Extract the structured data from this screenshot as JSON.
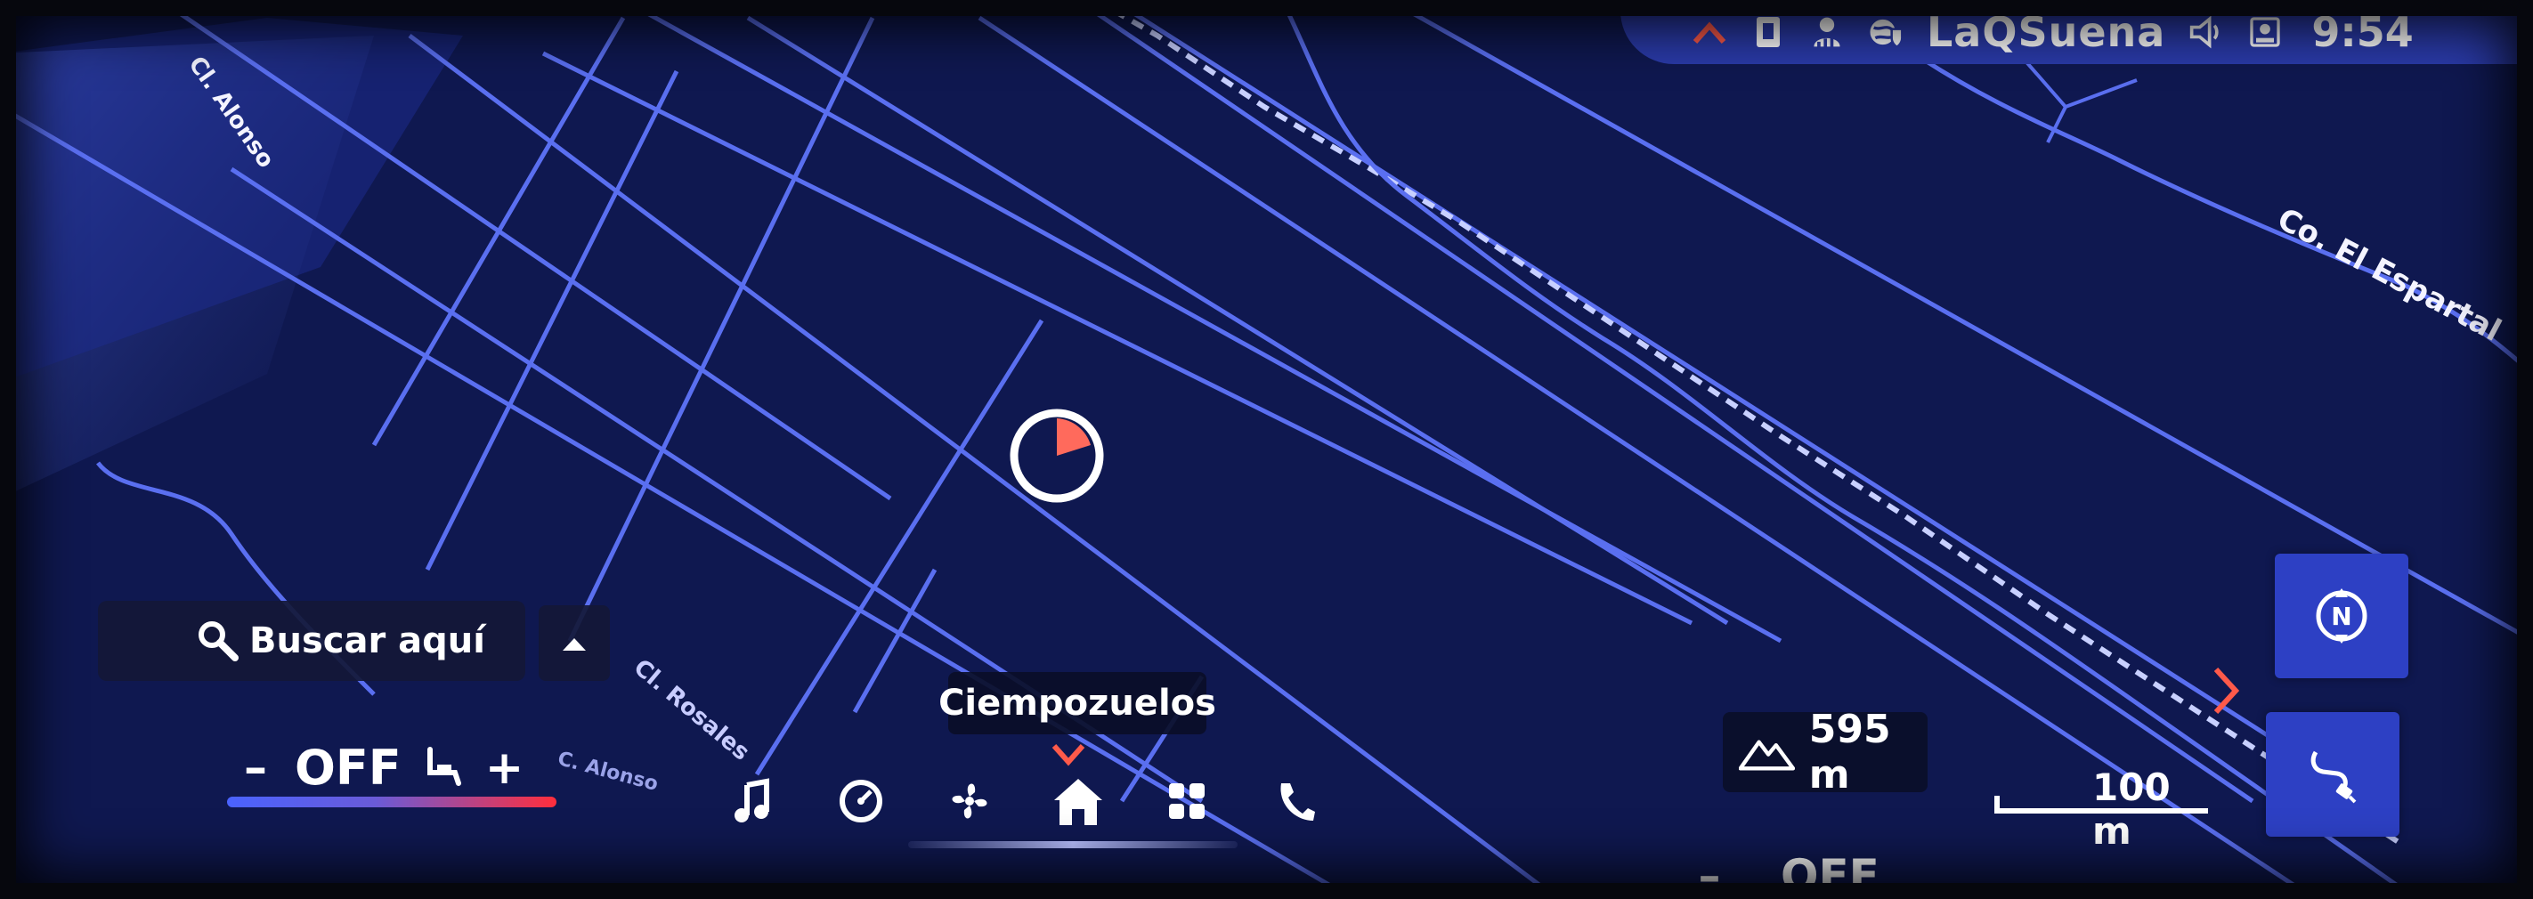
{
  "status_bar": {
    "network_name": "LaQSuena",
    "clock": "9:54",
    "icons": [
      "chevron-up-icon",
      "card-icon",
      "user-signal-icon",
      "globe-shield-icon",
      "speaker-icon",
      "profile-icon"
    ],
    "accent_color": "#ff5a4a"
  },
  "map": {
    "labels": {
      "street_top_left": "Cl. Alonso",
      "creek_right": "Co. El Espartal",
      "street_bottom": "Cl. Rosales",
      "street_bottom2": "C. Alonso"
    },
    "current_city": "Ciempozuelos",
    "elevation": "595 m",
    "scale": "100 m",
    "background_color": "#0f1850",
    "road_color": "#5a6ff0"
  },
  "search": {
    "label": "Buscar aquí"
  },
  "climate_left": {
    "minus": "–",
    "state": "OFF",
    "plus": "+"
  },
  "climate_right": {
    "minus": "–",
    "state": "OFF"
  },
  "dock": {
    "items": [
      "music-icon",
      "gauge-icon",
      "fan-icon",
      "home-icon",
      "apps-grid-icon",
      "phone-icon"
    ]
  }
}
